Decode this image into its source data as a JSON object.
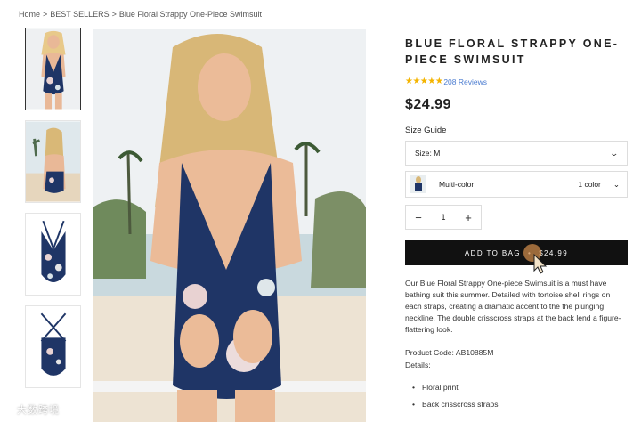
{
  "breadcrumb": {
    "home": "Home",
    "sep": ">",
    "category": "BEST SELLERS",
    "current": "Blue Floral Strappy One-Piece Swimsuit"
  },
  "product": {
    "title": "BLUE FLORAL STRAPPY ONE-PIECE SWIMSUIT",
    "stars": "★★★★★",
    "rating_value": 5,
    "reviews": "208 Reviews",
    "price": "$24.99",
    "size_guide": "Size Guide",
    "size_label": "Size: M",
    "color_label": "Multi-color",
    "color_count": "1 color",
    "quantity": "1",
    "minus": "−",
    "plus": "+",
    "add_to_bag": "ADD TO BAG",
    "bag_dot": "•",
    "bag_price": "$24.99",
    "description": "Our Blue Floral Strappy One-piece Swimsuit is a must have bathing suit this summer. Detailed with tortoise shell rings on each straps, creating a dramatic accent to the the plunging neckline. The double crisscross straps at the back lend a figure-flattering look.",
    "product_code": "Product Code: AB10885M",
    "details_label": "Details:",
    "details": [
      "Floral print",
      "Back crisscross straps"
    ]
  },
  "watermark": "大数跨境",
  "colors": {
    "accent_star": "#f4b400",
    "link_blue": "#4a7bd0",
    "button_bg": "#111111",
    "swimsuit_navy": "#1f3566"
  }
}
